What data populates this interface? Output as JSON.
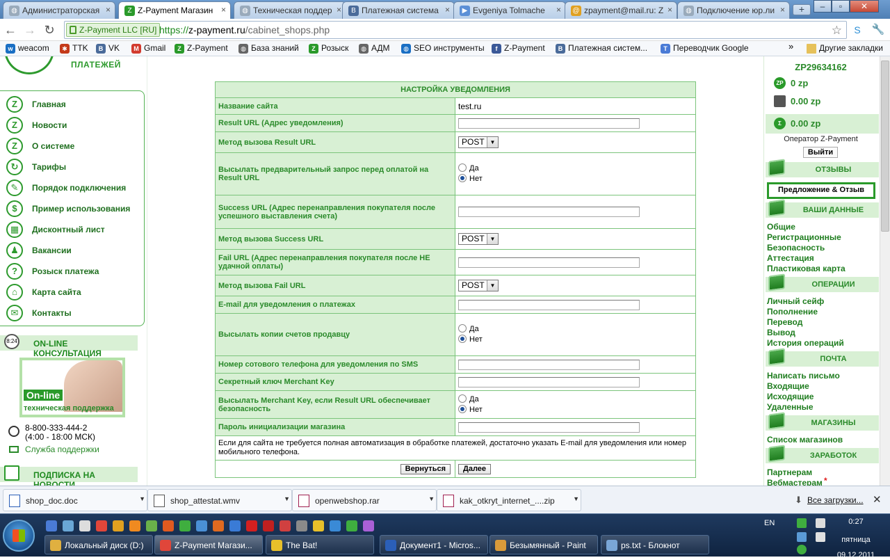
{
  "browser": {
    "tabs": [
      {
        "title": "Администраторская",
        "icon": "globe",
        "active": false
      },
      {
        "title": "Z-Payment Магазин",
        "icon": "z",
        "active": true
      },
      {
        "title": "Техническая поддер",
        "icon": "globe",
        "active": false
      },
      {
        "title": "Платежная система",
        "icon": "b",
        "active": false
      },
      {
        "title": "Evgeniya Tolmache",
        "icon": "play",
        "active": false
      },
      {
        "title": "zpayment@mail.ru: Z",
        "icon": "at",
        "active": false
      },
      {
        "title": "Подключение юр.ли",
        "icon": "globe",
        "active": false
      }
    ],
    "ev_badge": "Z-Payment LLC [RU]",
    "url_proto": "https://",
    "url_host": "z-payment.ru",
    "url_path": "/cabinet_shops.php",
    "bookmarks": [
      {
        "label": "weacom",
        "icon": "w",
        "color": "#1a6fc4"
      },
      {
        "label": "TTK",
        "icon": "ttk",
        "color": "#c43a1a"
      },
      {
        "label": "VK",
        "icon": "B",
        "color": "#4a6b9a"
      },
      {
        "label": "Gmail",
        "icon": "M",
        "color": "#d23b2e"
      },
      {
        "label": "Z-Payment",
        "icon": "Z",
        "color": "#2a9a2a"
      },
      {
        "label": "База знаний",
        "icon": "globe",
        "color": "#666666"
      },
      {
        "label": "Розыск",
        "icon": "Z",
        "color": "#2a9a2a"
      },
      {
        "label": "АДМ",
        "icon": "globe",
        "color": "#666666"
      },
      {
        "label": "SEO инструменты",
        "icon": "globe",
        "color": "#1a6fc4"
      },
      {
        "label": "Z-Payment",
        "icon": "f",
        "color": "#3b5998"
      },
      {
        "label": "Платежная систем...",
        "icon": "B",
        "color": "#4a6b9a"
      },
      {
        "label": "Переводчик Google",
        "icon": "T",
        "color": "#4a7bd6"
      }
    ],
    "other_bookmarks": "Другие закладки"
  },
  "left": {
    "logo_text": "ПЛАТЕЖЕЙ",
    "nav": [
      {
        "label": "Главная",
        "icon": "Z"
      },
      {
        "label": "Новости",
        "icon": "Z"
      },
      {
        "label": "О системе",
        "icon": "Z"
      },
      {
        "label": "Тарифы",
        "icon": "↻"
      },
      {
        "label": "Порядок подключения",
        "icon": "✎"
      },
      {
        "label": "Пример использования",
        "icon": "$"
      },
      {
        "label": "Дисконтный лист",
        "icon": "▦"
      },
      {
        "label": "Вакансии",
        "icon": "♟"
      },
      {
        "label": "Розыск платежа",
        "icon": "?"
      },
      {
        "label": "Карта сайта",
        "icon": "⌂"
      },
      {
        "label": "Контакты",
        "icon": "✉"
      }
    ],
    "online_header": "ON-LINE КОНСУЛЬТАЦИЯ",
    "online_badge_label": "On-line",
    "online_badge_sub": "техническая поддержка",
    "phone": "8-800-333-444-2",
    "phone_hours": "(4:00 - 18:00 МСК)",
    "support_link": "Служба поддержки",
    "subscribe_header": "ПОДПИСКА НА НОВОСТИ"
  },
  "form": {
    "title": "НАСТРОЙКА УВЕДОМЛЕНИЯ",
    "site_name_label": "Название сайта",
    "site_name_value": "test.ru",
    "result_url_label": "Result URL (Адрес уведомления)",
    "result_url_value": "",
    "result_method_label": "Метод вызова Result URL",
    "result_method_value": "POST",
    "prerequest_label": "Высылать предварительный запрос перед оплатой на Result URL",
    "prerequest_yes": "Да",
    "prerequest_no": "Нет",
    "success_url_label": "Success URL (Адрес перенаправления покупателя после успешного выставления счета)",
    "success_url_value": "",
    "success_method_label": "Метод вызова Success URL",
    "success_method_value": "POST",
    "fail_url_label": "Fail URL (Адрес перенаправления покупателя после НЕ удачной оплаты)",
    "fail_url_value": "",
    "fail_method_label": "Метод вызова Fail URL",
    "fail_method_value": "POST",
    "email_label": "E-mail для уведомления о платежах",
    "email_value": "",
    "copies_label": "Высылать копии счетов продавцу",
    "copies_yes": "Да",
    "copies_no": "Нет",
    "phone_label": "Номер сотового телефона для уведомления по SMS",
    "phone_value": "",
    "merchant_key_label": "Секретный ключ Merchant Key",
    "merchant_key_value": "",
    "send_key_label": "Высылать Merchant Key, если Result URL обеспечивает безопасность",
    "send_key_yes": "Да",
    "send_key_no": "Нет",
    "init_password_label": "Пароль инициализации магазина",
    "init_password_value": "",
    "note": "Если для сайта не требуется полная автоматизация в обработке платежей, достаточно указать E-mail для уведомления или номер мобильного телефона.",
    "back_button": "Вернуться",
    "next_button": "Далее"
  },
  "right": {
    "account_id": "ZP29634162",
    "balance_zp": "0 zp",
    "balance_safe": "0.00 zp",
    "balance_total": "0.00 zp",
    "operator": "Оператор Z-Payment",
    "logout": "Выйти",
    "reviews_header": "ОТЗЫВЫ",
    "feedback_button": "Предложение & Отзыв",
    "your_data_header": "ВАШИ ДАННЫЕ",
    "your_data_links": [
      "Общие",
      "Регистрационные",
      "Безопасность",
      "Аттестация",
      "Пластиковая карта"
    ],
    "operations_header": "ОПЕРАЦИИ",
    "operations_links": [
      "Личный сейф",
      "Пополнение",
      "Перевод",
      "Вывод",
      "История операций"
    ],
    "mail_header": "ПОЧТА",
    "mail_links": [
      "Написать письмо",
      "Входящие",
      "Исходящие",
      "Удаленные"
    ],
    "shops_header": "МАГАЗИНЫ",
    "shops_links": [
      "Список магазинов"
    ],
    "earnings_header": "ЗАРАБОТОК",
    "earnings_links": [
      "Партнерам",
      "Вебмастерам"
    ],
    "webmaster_star": "*"
  },
  "downloads": {
    "items": [
      "shop_doc.doc",
      "shop_attestat.wmv",
      "openwebshop.rar",
      "kak_otkryt_internet_....zip"
    ],
    "all_downloads": "Все загрузки..."
  },
  "taskbar": {
    "tasks": [
      {
        "label": "Локальный диск (D:)",
        "color": "#e0b040"
      },
      {
        "label": "Z-Payment Магази...",
        "color": "#e0463a"
      },
      {
        "label": "The Bat!",
        "color": "#e8c02a"
      },
      {
        "label": "Документ1 - Micros...",
        "color": "#2b5fb8"
      },
      {
        "label": "Безымянный - Paint",
        "color": "#d99a3a"
      },
      {
        "label": "ps.txt - Блокнот",
        "color": "#7aa6d6"
      }
    ],
    "lang": "EN",
    "time": "0:27",
    "day": "пятница",
    "date": "09.12.2011"
  }
}
